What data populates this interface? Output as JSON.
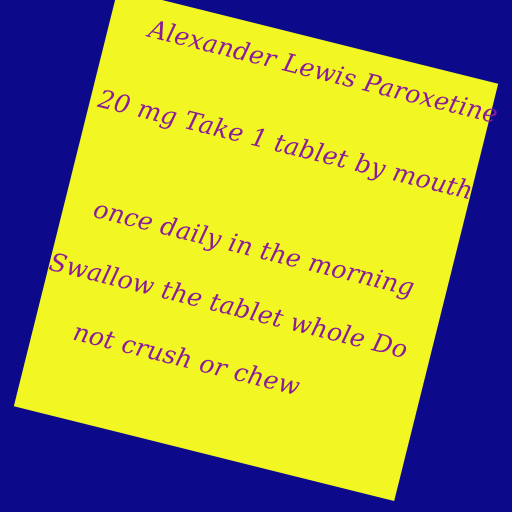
{
  "colors": {
    "background": "#0c0a8a",
    "paper": "#f2f623",
    "ink": "#8a1c98"
  },
  "note": {
    "lines": [
      "Alexander Lewis Paroxetine",
      "20 mg Take 1 tablet by mouth",
      "once daily in the morning",
      "Swallow the tablet whole Do",
      "not crush or chew"
    ]
  }
}
